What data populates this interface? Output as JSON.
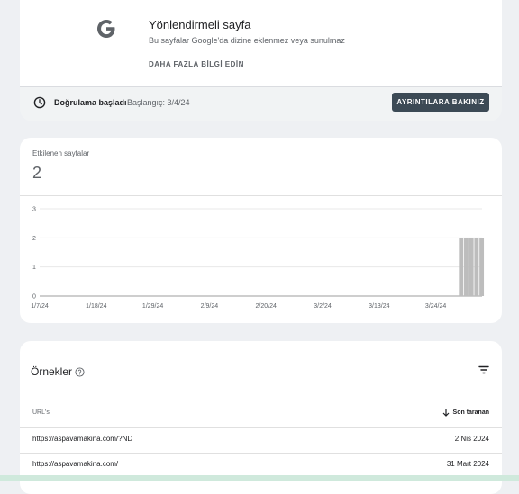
{
  "issue": {
    "title": "Yönlendirmeli sayfa",
    "description": "Bu sayfalar Google'da dizine eklenmez veya sunulmaz",
    "learn_more": "DAHA FAZLA BİLGİ EDİN",
    "logo_icon": "google-g-icon"
  },
  "validation": {
    "status": "Doğrulama başladı",
    "start": "Başlangıç: 3/4/24",
    "details_button": "AYRINTILARA BAKINIZ",
    "icon": "clock-icon"
  },
  "affected": {
    "label": "Etkilenen sayfalar",
    "count": "2"
  },
  "chart_data": {
    "type": "bar",
    "ylim": [
      0,
      3
    ],
    "yticks": [
      "0",
      "1",
      "2",
      "3"
    ],
    "xticks": [
      "1/7/24",
      "1/18/24",
      "1/29/24",
      "2/9/24",
      "2/20/24",
      "3/2/24",
      "3/13/24",
      "3/24/24"
    ],
    "start": "2024-01-07",
    "end": "2024-04-02",
    "series": [
      {
        "values": [
          {
            "date": "2024-03-29",
            "value": 2
          },
          {
            "date": "2024-03-30",
            "value": 2
          },
          {
            "date": "2024-03-31",
            "value": 2
          },
          {
            "date": "2024-04-01",
            "value": 2
          },
          {
            "date": "2024-04-02",
            "value": 2
          }
        ]
      }
    ],
    "grid": true,
    "bar_color": "#bdbdbd"
  },
  "examples": {
    "title": "Örnekler",
    "col_url": "URL'si",
    "col_last": "Son taranan",
    "rows": [
      {
        "url": "https://aspavamakina.com/?ND",
        "date": "2 Nis 2024"
      },
      {
        "url": "https://aspavamakina.com/",
        "date": "31 Mart 2024"
      }
    ]
  }
}
